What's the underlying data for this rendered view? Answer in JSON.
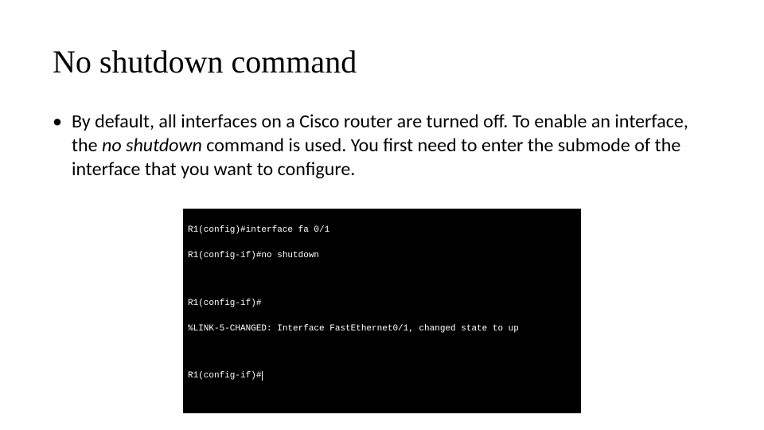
{
  "title": "No shutdown command",
  "bullet": {
    "pre": "By default, all interfaces on a Cisco router are turned off. To enable an interface, the ",
    "em": "no shutdown",
    "post": " command is used. You first need to enter the submode of the interface that you want to configure."
  },
  "terminal": {
    "line1": "R1(config)#interface fa 0/1",
    "line2": "R1(config-if)#no shutdown",
    "line3": "R1(config-if)#",
    "line4": "%LINK-5-CHANGED: Interface FastEthernet0/1, changed state to up",
    "line5": "R1(config-if)#"
  }
}
